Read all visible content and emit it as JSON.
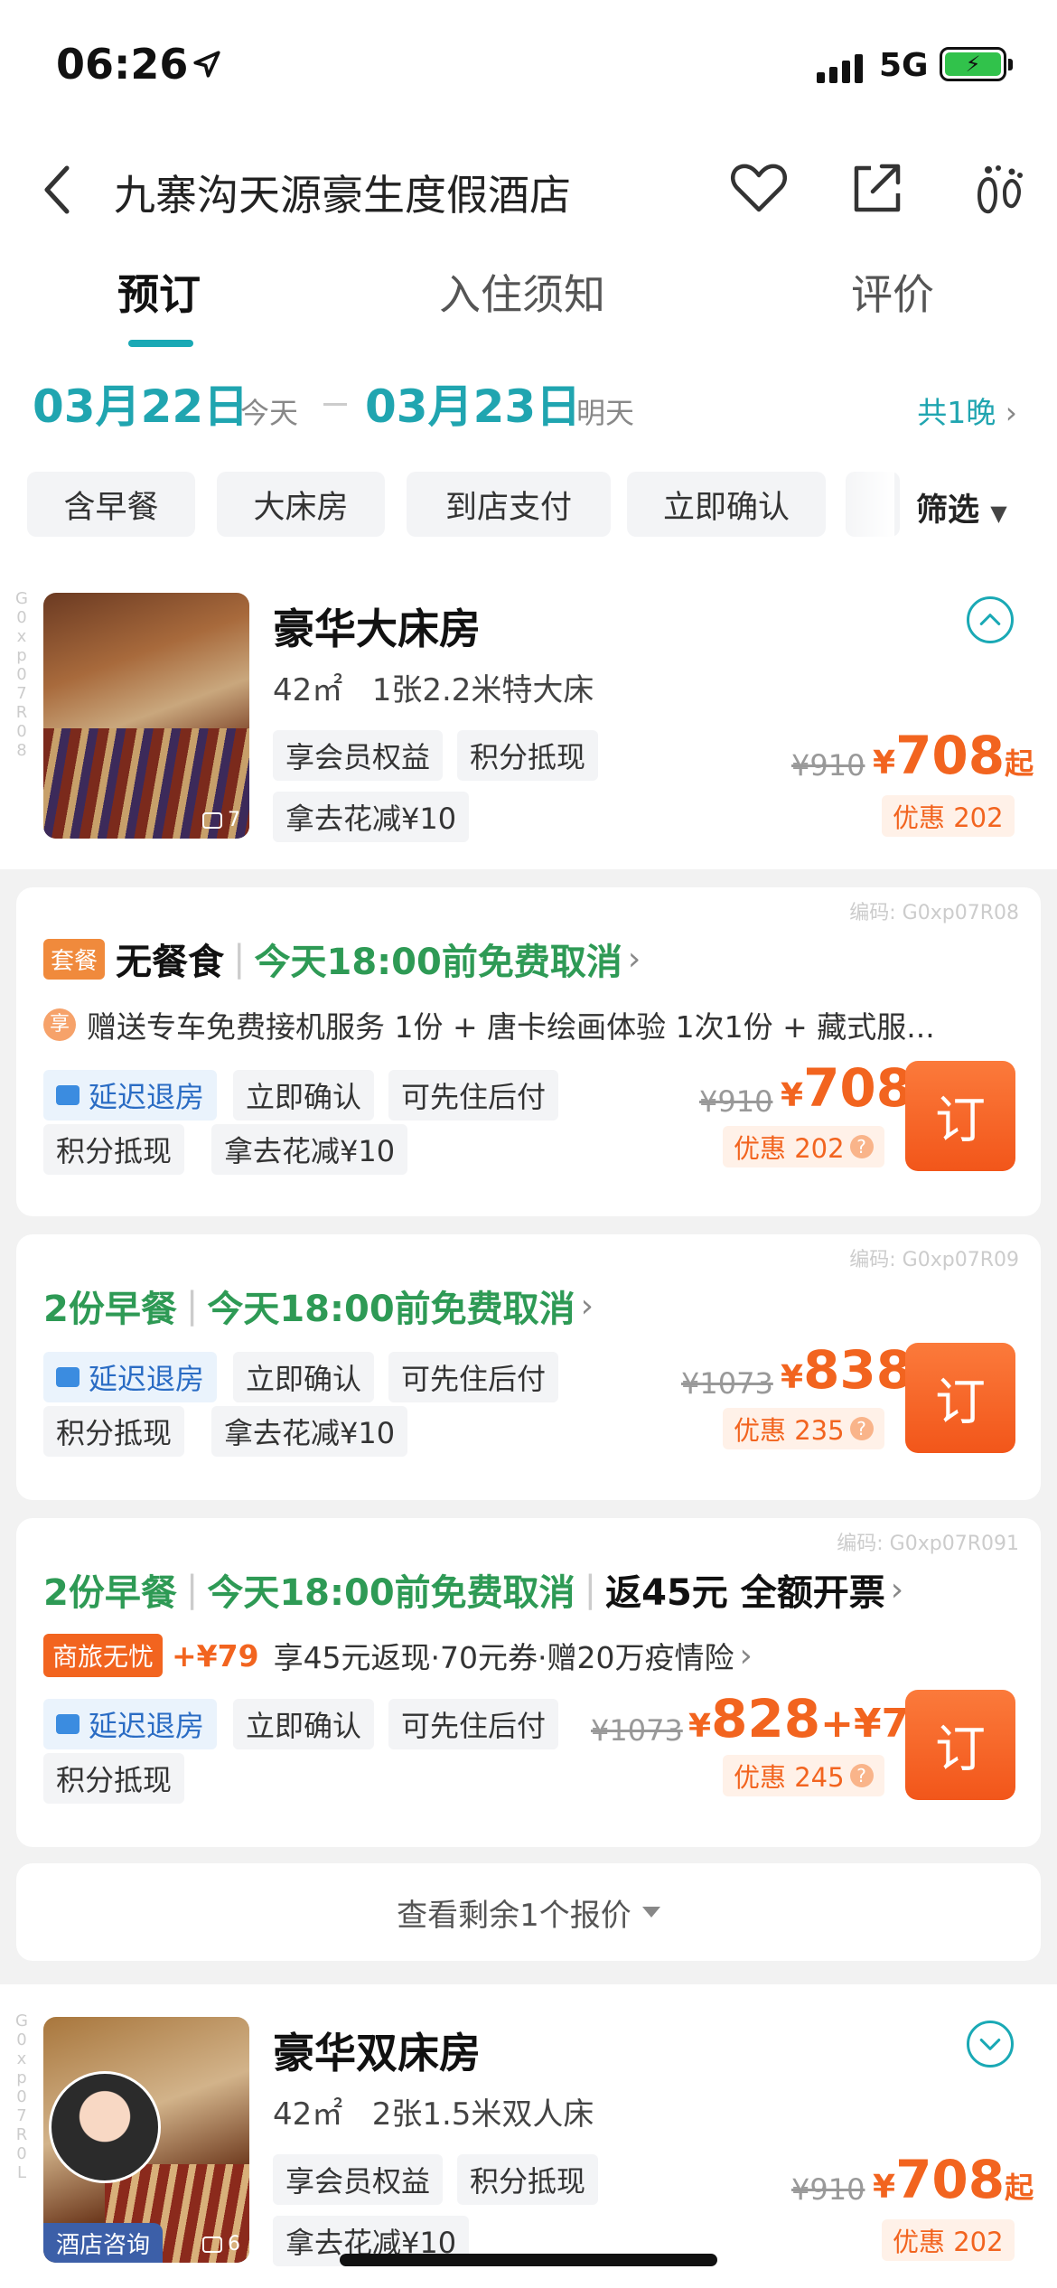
{
  "status": {
    "time": "06:26",
    "network": "5G",
    "battery_icon": "battery-charging-icon",
    "location_icon": "location-arrow-icon"
  },
  "nav": {
    "title": "九寨沟天源豪生度假酒店",
    "back_icon": "chevron-left-icon",
    "favorite_icon": "heart-icon",
    "share_icon": "share-icon",
    "footprint_icon": "footprint-icon"
  },
  "tabs": [
    {
      "label": "预订",
      "active": true
    },
    {
      "label": "入住须知"
    },
    {
      "label": "评价"
    }
  ],
  "dates": {
    "checkin": "03月22日",
    "checkin_label": "今天",
    "checkout": "03月23日",
    "checkout_label": "明天",
    "nights": "共1晚"
  },
  "filters": {
    "chips": [
      "含早餐",
      "大床房",
      "到店支付",
      "立即确认"
    ],
    "filter_label": "筛选"
  },
  "rooms": [
    {
      "code_vertical": [
        "G",
        "0",
        "x",
        "p",
        "0",
        "7",
        "R",
        "0",
        "8"
      ],
      "name": "豪华大床房",
      "area": "42㎡",
      "bed": "1张2.2米特大床",
      "tags": [
        "享会员权益",
        "积分抵现",
        "拿去花减¥10"
      ],
      "photo_count": "7",
      "orig_price": "¥910",
      "yen": "¥",
      "price": "708",
      "qi": "起",
      "discount": "优惠 202"
    },
    {
      "code_vertical": [
        "G",
        "0",
        "x",
        "p",
        "0",
        "7",
        "R",
        "0",
        "L"
      ],
      "name": "豪华双床房",
      "area": "42㎡",
      "bed": "2张1.5米双人床",
      "tags": [
        "享会员权益",
        "积分抵现",
        "拿去花减¥10"
      ],
      "photo_count": "6",
      "consult_label": "酒店咨询",
      "orig_price": "¥910",
      "yen": "¥",
      "price": "708",
      "qi": "起",
      "discount": "优惠 202"
    }
  ],
  "offers": [
    {
      "code": "编码: G0xp07R08",
      "meal_badge": "套餐",
      "meal": "无餐食",
      "cancel": "今天18:00前免费取消",
      "gift_icon": "享",
      "gift": "赠送专车免费接机服务 1份 + 唐卡绘画体验 1次1份 + 藏式服...",
      "late": "延迟退房",
      "tags": [
        "立即确认",
        "可先住后付",
        "积分抵现",
        "拿去花减¥10"
      ],
      "orig_price": "¥910",
      "yen": "¥",
      "price": "708",
      "discount": "优惠 202",
      "book": "订"
    },
    {
      "code": "编码: G0xp07R09",
      "meal": "2份早餐",
      "cancel": "今天18:00前免费取消",
      "late": "延迟退房",
      "tags": [
        "立即确认",
        "可先住后付",
        "积分抵现",
        "拿去花减¥10"
      ],
      "orig_price": "¥1073",
      "yen": "¥",
      "price": "838",
      "discount": "优惠 235",
      "book": "订"
    },
    {
      "code": "编码: G0xp07R091",
      "meal": "2份早餐",
      "cancel": "今天18:00前免费取消",
      "extra": "返45元 全额开票",
      "biz_badge": "商旅无忧",
      "biz_add": "+¥79",
      "biz_text": "享45元返现·70元券·赠20万疫情险",
      "late": "延迟退房",
      "tags": [
        "立即确认",
        "可先住后付",
        "积分抵现"
      ],
      "orig_price": "¥1073",
      "yen": "¥",
      "price": "828",
      "price_add": "+¥79",
      "discount": "优惠 245",
      "book": "订"
    }
  ],
  "more": {
    "label": "查看剩余1个报价"
  },
  "colors": {
    "accent": "#1aa9b5",
    "price": "#f2641f",
    "green": "#2e9a55"
  }
}
